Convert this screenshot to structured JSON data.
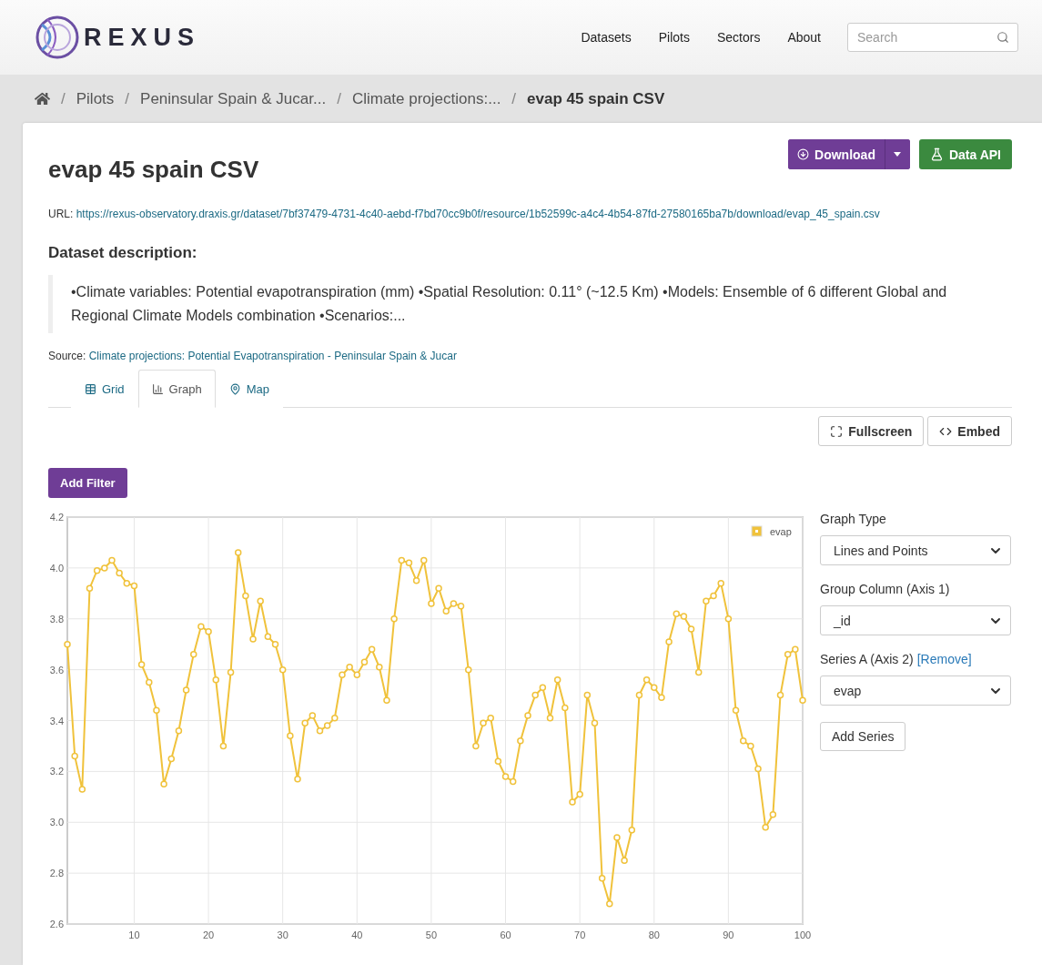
{
  "logo": {
    "text": "REXUS"
  },
  "nav": {
    "items": [
      "Datasets",
      "Pilots",
      "Sectors",
      "About"
    ],
    "search": {
      "placeholder": "Search"
    }
  },
  "breadcrumb": {
    "separator": "/",
    "items": [
      {
        "label": "Pilots",
        "active": false
      },
      {
        "label": "Peninsular Spain & Jucar...",
        "active": false
      },
      {
        "label": "Climate projections:...",
        "active": false
      },
      {
        "label": "evap 45 spain CSV",
        "active": true
      }
    ]
  },
  "title": "evap 45 spain CSV",
  "actions": {
    "download": "Download",
    "data_api": "Data API"
  },
  "url": {
    "label": "URL:",
    "link": "https://rexus-observatory.draxis.gr/dataset/7bf37479-4731-4c40-aebd-f7bd70cc9b0f/resource/1b52599c-a4c4-4b54-87fd-27580165ba7b/download/evap_45_spain.csv"
  },
  "description": {
    "heading": "Dataset description:",
    "text": "•Climate variables: Potential evapotranspiration (mm) •Spatial Resolution: 0.11° (~12.5 Km) •Models: Ensemble of 6 different Global and Regional Climate Models combination •Scenarios:..."
  },
  "source": {
    "label": "Source:",
    "link": "Climate projections: Potential Evapotranspiration - Peninsular Spain & Jucar"
  },
  "tabs": [
    {
      "label": "Grid",
      "kind": "grid",
      "selected": false
    },
    {
      "label": "Graph",
      "kind": "graph",
      "selected": true
    },
    {
      "label": "Map",
      "kind": "map",
      "selected": false
    }
  ],
  "view_buttons": {
    "fullscreen": "Fullscreen",
    "embed": "Embed"
  },
  "add_filter": "Add Filter",
  "controls": {
    "graph_type": {
      "label": "Graph Type",
      "value": "Lines and Points"
    },
    "group_column": {
      "label": "Group Column (Axis 1)",
      "value": "_id"
    },
    "series_a": {
      "label": "Series A (Axis 2)",
      "remove": "[Remove]",
      "value": "evap"
    },
    "add_series": "Add Series"
  },
  "chart_data": {
    "type": "line",
    "grid": true,
    "xlim": [
      1,
      100
    ],
    "ylim": [
      2.6,
      4.2
    ],
    "xticks": [
      10,
      20,
      30,
      40,
      50,
      60,
      70,
      80,
      90,
      100
    ],
    "yticks": [
      2.6,
      2.8,
      {
        "value": 3,
        "label": "3.0"
      },
      3.2,
      3.4,
      3.6,
      3.8,
      {
        "value": 4,
        "label": "4.0"
      },
      4.2
    ],
    "x": [
      1,
      2,
      3,
      4,
      5,
      6,
      7,
      8,
      9,
      10,
      11,
      12,
      13,
      14,
      15,
      16,
      17,
      18,
      19,
      20,
      21,
      22,
      23,
      24,
      25,
      26,
      27,
      28,
      29,
      30,
      31,
      32,
      33,
      34,
      35,
      36,
      37,
      38,
      39,
      40,
      41,
      42,
      43,
      44,
      45,
      46,
      47,
      48,
      49,
      50,
      51,
      52,
      53,
      54,
      55,
      56,
      57,
      58,
      59,
      60,
      61,
      62,
      63,
      64,
      65,
      66,
      67,
      68,
      69,
      70,
      71,
      72,
      73,
      74,
      75,
      76,
      77,
      78,
      79,
      80,
      81,
      82,
      83,
      84,
      85,
      86,
      87,
      88,
      89,
      90,
      91,
      92,
      93,
      94,
      95,
      96,
      97,
      98,
      99,
      100
    ],
    "series": [
      {
        "name": "evap",
        "color": "#f0c23b",
        "marker": "circle",
        "values": [
          3.7,
          3.26,
          3.13,
          3.92,
          3.99,
          4.0,
          4.03,
          3.98,
          3.94,
          3.93,
          3.62,
          3.55,
          3.44,
          3.15,
          3.25,
          3.36,
          3.52,
          3.66,
          3.77,
          3.75,
          3.56,
          3.3,
          3.59,
          4.06,
          3.89,
          3.72,
          3.87,
          3.73,
          3.7,
          3.6,
          3.34,
          3.17,
          3.39,
          3.42,
          3.36,
          3.38,
          3.41,
          3.58,
          3.61,
          3.58,
          3.63,
          3.68,
          3.61,
          3.48,
          3.8,
          4.03,
          4.02,
          3.95,
          4.03,
          3.86,
          3.92,
          3.83,
          3.86,
          3.85,
          3.6,
          3.3,
          3.39,
          3.41,
          3.24,
          3.18,
          3.16,
          3.32,
          3.42,
          3.5,
          3.53,
          3.41,
          3.56,
          3.45,
          3.08,
          3.11,
          3.5,
          3.39,
          2.78,
          2.68,
          2.94,
          2.85,
          2.97,
          3.5,
          3.56,
          3.53,
          3.49,
          3.71,
          3.82,
          3.81,
          3.76,
          3.59,
          3.87,
          3.89,
          3.94,
          3.8,
          3.44,
          3.32,
          3.3,
          3.21,
          2.98,
          3.03,
          3.5,
          3.66,
          3.68,
          3.48
        ]
      }
    ]
  }
}
